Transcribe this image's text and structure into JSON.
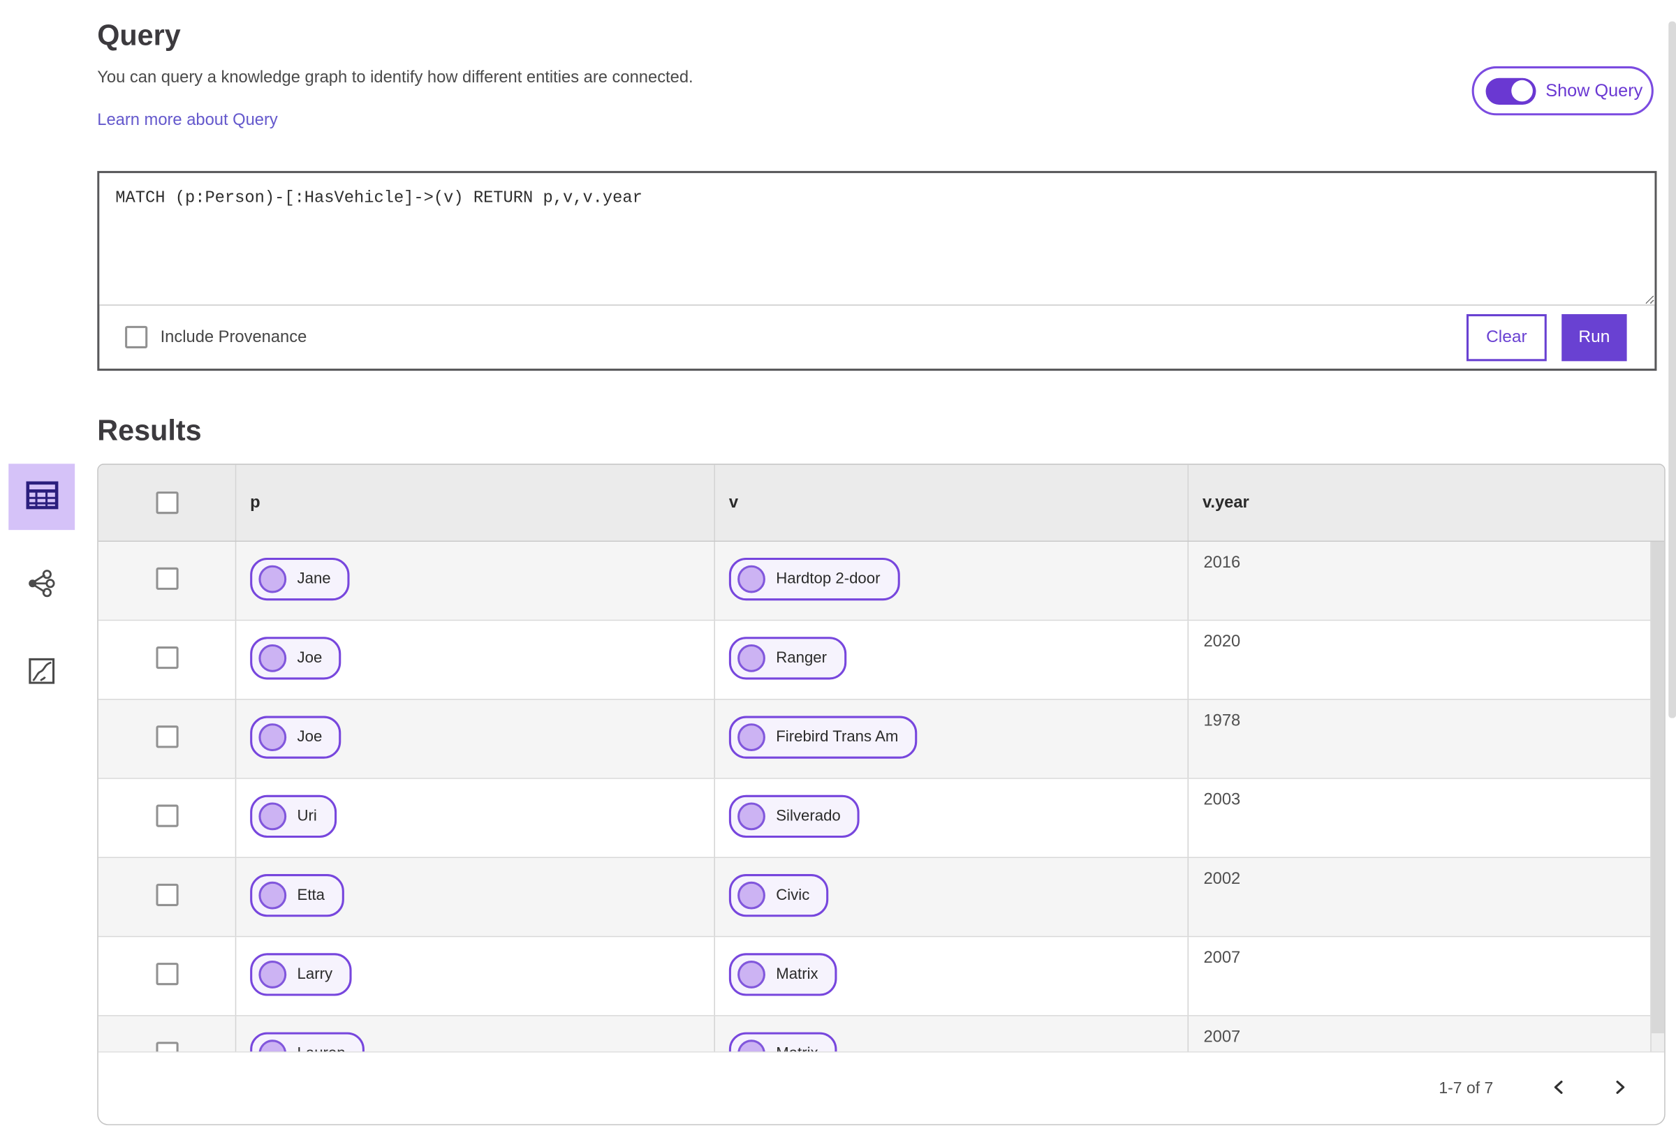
{
  "colors": {
    "accent": "#6941d2",
    "toggle_fill": "#6a38d2",
    "link": "#6458cc",
    "pill_border": "#7746dd",
    "pill_bg": "#f6f3fd",
    "node_fill": "#ccb3f3",
    "active_view_bg": "#d5c2f8",
    "table_header_bg": "#ebebeb",
    "row_alt_bg": "#f5f5f5"
  },
  "query_section": {
    "title": "Query",
    "description": "You can query a knowledge graph to identify how different entities are connected.",
    "learn_more_link": "Learn more about Query",
    "show_query_toggle": {
      "label": "Show Query",
      "state": "on"
    },
    "query_input": {
      "value": "MATCH (p:Person)-[:HasVehicle]->(v) RETURN p,v,v.year"
    },
    "include_provenance": {
      "label": "Include Provenance",
      "checked": false
    },
    "buttons": {
      "clear": "Clear",
      "run": "Run"
    }
  },
  "results_section": {
    "title": "Results",
    "view_switcher": [
      {
        "icon": "table-view-icon",
        "active": true
      },
      {
        "icon": "network-view-icon",
        "active": false
      },
      {
        "icon": "map-view-icon",
        "active": false
      }
    ],
    "table": {
      "select_all_checked": false,
      "columns": [
        "p",
        "v",
        "v.year"
      ],
      "rows": [
        {
          "p": "Jane",
          "v": "Hardtop 2-door",
          "year": "2016"
        },
        {
          "p": "Joe",
          "v": "Ranger",
          "year": "2020"
        },
        {
          "p": "Joe",
          "v": "Firebird Trans Am",
          "year": "1978"
        },
        {
          "p": "Uri",
          "v": "Silverado",
          "year": "2003"
        },
        {
          "p": "Etta",
          "v": "Civic",
          "year": "2002"
        },
        {
          "p": "Larry",
          "v": "Matrix",
          "year": "2007"
        },
        {
          "p": "Lauren",
          "v": "Matrix",
          "year": "2007"
        }
      ]
    },
    "pagination": {
      "range_label": "1-7 of 7",
      "prev_icon": "chevron-left-icon",
      "next_icon": "chevron-right-icon"
    }
  }
}
